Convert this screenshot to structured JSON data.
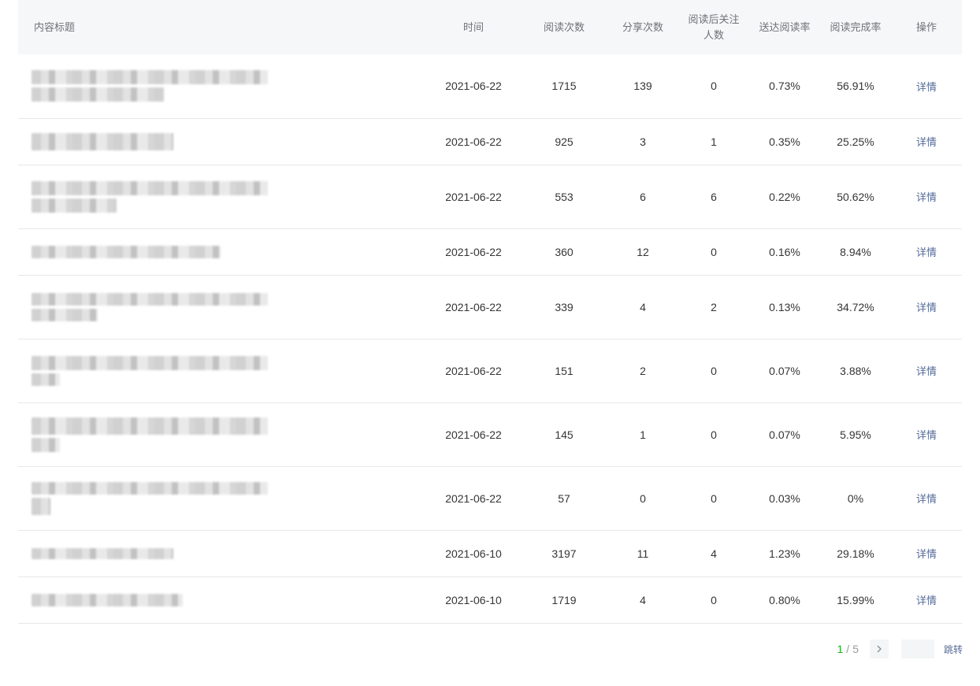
{
  "table": {
    "headers": {
      "title": "内容标题",
      "time": "时间",
      "reads": "阅读次数",
      "shares": "分享次数",
      "follows_line1": "阅读后关注",
      "follows_line2": "人数",
      "delivery_rate": "送达阅读率",
      "completion_rate": "阅读完成率",
      "action": "操作"
    },
    "rows": [
      {
        "date": "2021-06-22",
        "reads": "1715",
        "shares": "139",
        "follows": "0",
        "delivery_rate": "0.73%",
        "completion_rate": "56.91%",
        "action": "详情"
      },
      {
        "date": "2021-06-22",
        "reads": "925",
        "shares": "3",
        "follows": "1",
        "delivery_rate": "0.35%",
        "completion_rate": "25.25%",
        "action": "详情"
      },
      {
        "date": "2021-06-22",
        "reads": "553",
        "shares": "6",
        "follows": "6",
        "delivery_rate": "0.22%",
        "completion_rate": "50.62%",
        "action": "详情"
      },
      {
        "date": "2021-06-22",
        "reads": "360",
        "shares": "12",
        "follows": "0",
        "delivery_rate": "0.16%",
        "completion_rate": "8.94%",
        "action": "详情"
      },
      {
        "date": "2021-06-22",
        "reads": "339",
        "shares": "4",
        "follows": "2",
        "delivery_rate": "0.13%",
        "completion_rate": "34.72%",
        "action": "详情"
      },
      {
        "date": "2021-06-22",
        "reads": "151",
        "shares": "2",
        "follows": "0",
        "delivery_rate": "0.07%",
        "completion_rate": "3.88%",
        "action": "详情"
      },
      {
        "date": "2021-06-22",
        "reads": "145",
        "shares": "1",
        "follows": "0",
        "delivery_rate": "0.07%",
        "completion_rate": "5.95%",
        "action": "详情"
      },
      {
        "date": "2021-06-22",
        "reads": "57",
        "shares": "0",
        "follows": "0",
        "delivery_rate": "0.03%",
        "completion_rate": "0%",
        "action": "详情"
      },
      {
        "date": "2021-06-10",
        "reads": "3197",
        "shares": "11",
        "follows": "4",
        "delivery_rate": "1.23%",
        "completion_rate": "29.18%",
        "action": "详情"
      },
      {
        "date": "2021-06-10",
        "reads": "1719",
        "shares": "4",
        "follows": "0",
        "delivery_rate": "0.80%",
        "completion_rate": "15.99%",
        "action": "详情"
      }
    ]
  },
  "pagination": {
    "current": "1",
    "separator": "/",
    "total": "5",
    "next_icon": "chevron-right-icon",
    "jump_label": "跳转",
    "jump_value": ""
  }
}
